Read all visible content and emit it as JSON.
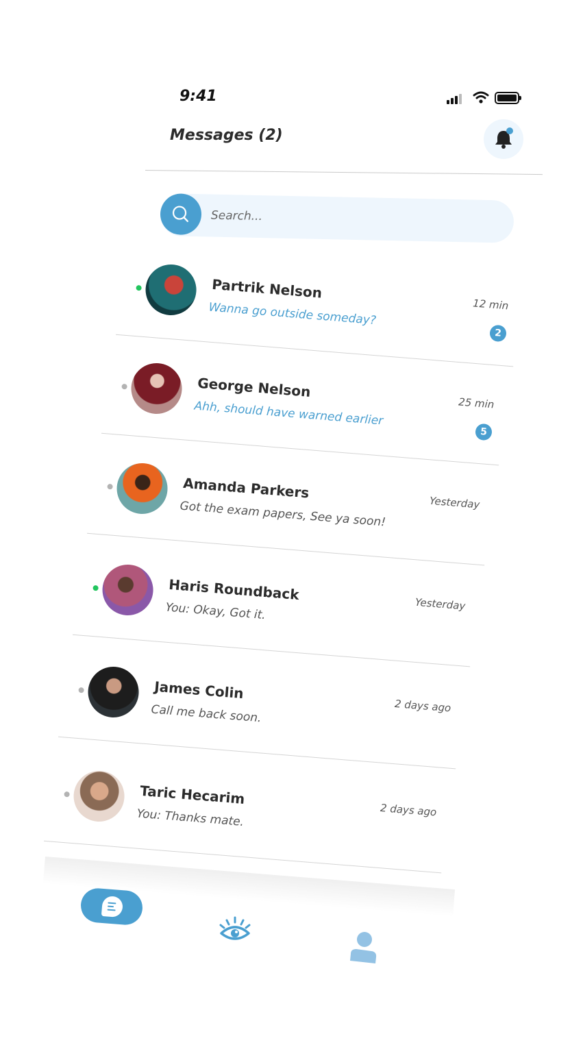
{
  "status_bar": {
    "time": "9:41"
  },
  "header": {
    "title": "Messages (2)"
  },
  "search": {
    "placeholder": "Search..."
  },
  "conversations": [
    {
      "name": "Partrik Nelson",
      "preview": "Wanna go outside someday?",
      "time": "12 min",
      "unread": "2",
      "online": true
    },
    {
      "name": "George Nelson",
      "preview": "Ahh, should have warned earlier",
      "time": "25 min",
      "unread": "5",
      "online": false
    },
    {
      "name": "Amanda Parkers",
      "preview": "Got the exam papers, See ya soon!",
      "time": "Yesterday",
      "online": false
    },
    {
      "name": "Haris Roundback",
      "preview": "You: Okay, Got it.",
      "time": "Yesterday",
      "online": true
    },
    {
      "name": "James Colin",
      "preview": "Call me back soon.",
      "time": "2 days ago",
      "online": false
    },
    {
      "name": "Taric Hecarim",
      "preview": "You: Thanks mate.",
      "time": "2 days ago",
      "online": false
    }
  ],
  "colors": {
    "accent": "#4a9fd0",
    "online": "#22c55e",
    "offline": "#b3b3b3",
    "search_bg": "#eef6fd"
  },
  "icons": [
    "signal-icon",
    "wifi-icon",
    "battery-icon",
    "bell-icon",
    "search-icon",
    "chat-icon",
    "eye-icon",
    "profile-icon"
  ]
}
